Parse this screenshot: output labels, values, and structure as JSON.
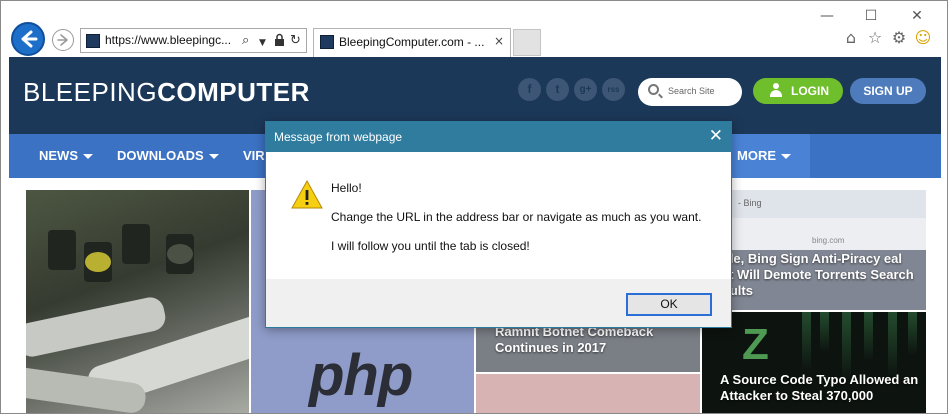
{
  "browser": {
    "address_url": "https://www.bleepingc...",
    "tab_title": "BleepingComputer.com - ...",
    "tab_close": "×",
    "window_controls": [
      "—",
      "☐",
      "✕"
    ],
    "toolbar_icons": [
      "home-icon",
      "star-icon",
      "gear-icon",
      "smiley-icon"
    ]
  },
  "site": {
    "logo_light": "BLEEPING",
    "logo_bold": "COMPUTER",
    "social_icons": [
      "f",
      "t",
      "g+",
      "rss"
    ],
    "search_placeholder": "Search Site",
    "login_label": "LOGIN",
    "signup_label": "SIGN UP",
    "nav": [
      {
        "label": "NEWS"
      },
      {
        "label": "DOWNLOADS"
      },
      {
        "label": "VIR"
      },
      {
        "label": "MORE"
      }
    ],
    "colors": {
      "header": "#1c3859",
      "nav": "#3c72c4",
      "login": "#6fbe2c",
      "signup": "#4e7bbb"
    }
  },
  "tiles": {
    "php_text": "php",
    "ramnit_title": "Ramnit Botnet Comeback Continues in 2017",
    "bing_bar_text": "- Bing",
    "bing_url": "bing.com",
    "google_bing_title": "oogle, Bing Sign Anti-Piracy eal That Will Demote Torrents Search Results",
    "typo_title": "A Source Code Typo Allowed an Attacker to Steal 370,000"
  },
  "dialog": {
    "title": "Message from webpage",
    "close": "✕",
    "line1": "Hello!",
    "line2": " Change the URL in the address bar or navigate as much as you want.",
    "line3": "I will follow you until the tab is closed!",
    "ok_label": "OK",
    "colors": {
      "titlebar": "#2f7c9e",
      "ok_border": "#2b6fd6"
    }
  }
}
